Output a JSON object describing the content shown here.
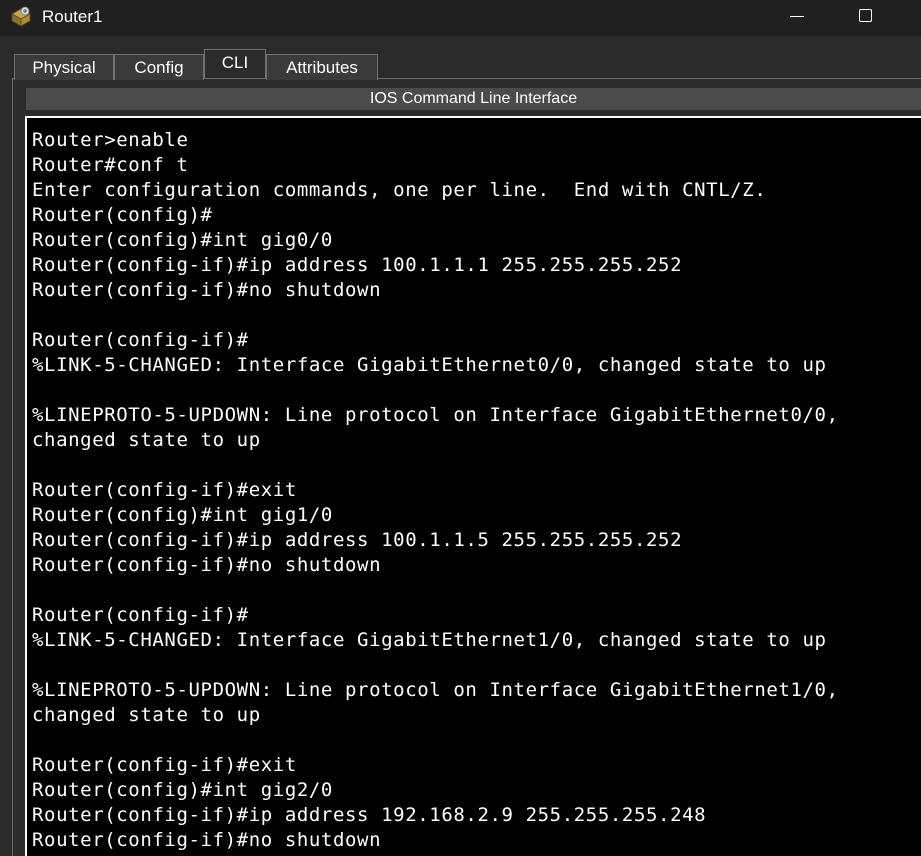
{
  "window": {
    "title": "Router1",
    "icon": "router-device-icon",
    "controls": [
      "minimize-icon",
      "maximize-icon"
    ]
  },
  "tabs": [
    {
      "label": "Physical",
      "active": false
    },
    {
      "label": "Config",
      "active": false
    },
    {
      "label": "CLI",
      "active": true
    },
    {
      "label": "Attributes",
      "active": false
    }
  ],
  "section": {
    "title": "IOS Command Line Interface"
  },
  "terminal": {
    "background": "#000000",
    "foreground": "#ffffff",
    "lines": [
      "Router>enable",
      "Router#conf t",
      "Enter configuration commands, one per line.  End with CNTL/Z.",
      "Router(config)#",
      "Router(config)#int gig0/0",
      "Router(config-if)#ip address 100.1.1.1 255.255.255.252",
      "Router(config-if)#no shutdown",
      "",
      "Router(config-if)#",
      "%LINK-5-CHANGED: Interface GigabitEthernet0/0, changed state to up",
      "",
      "%LINEPROTO-5-UPDOWN: Line protocol on Interface GigabitEthernet0/0,",
      "changed state to up",
      "",
      "Router(config-if)#exit",
      "Router(config)#int gig1/0",
      "Router(config-if)#ip address 100.1.1.5 255.255.255.252",
      "Router(config-if)#no shutdown",
      "",
      "Router(config-if)#",
      "%LINK-5-CHANGED: Interface GigabitEthernet1/0, changed state to up",
      "",
      "%LINEPROTO-5-UPDOWN: Line protocol on Interface GigabitEthernet1/0,",
      "changed state to up",
      "",
      "Router(config-if)#exit",
      "Router(config)#int gig2/0",
      "Router(config-if)#ip address 192.168.2.9 255.255.255.248",
      "Router(config-if)#no shutdown"
    ]
  }
}
